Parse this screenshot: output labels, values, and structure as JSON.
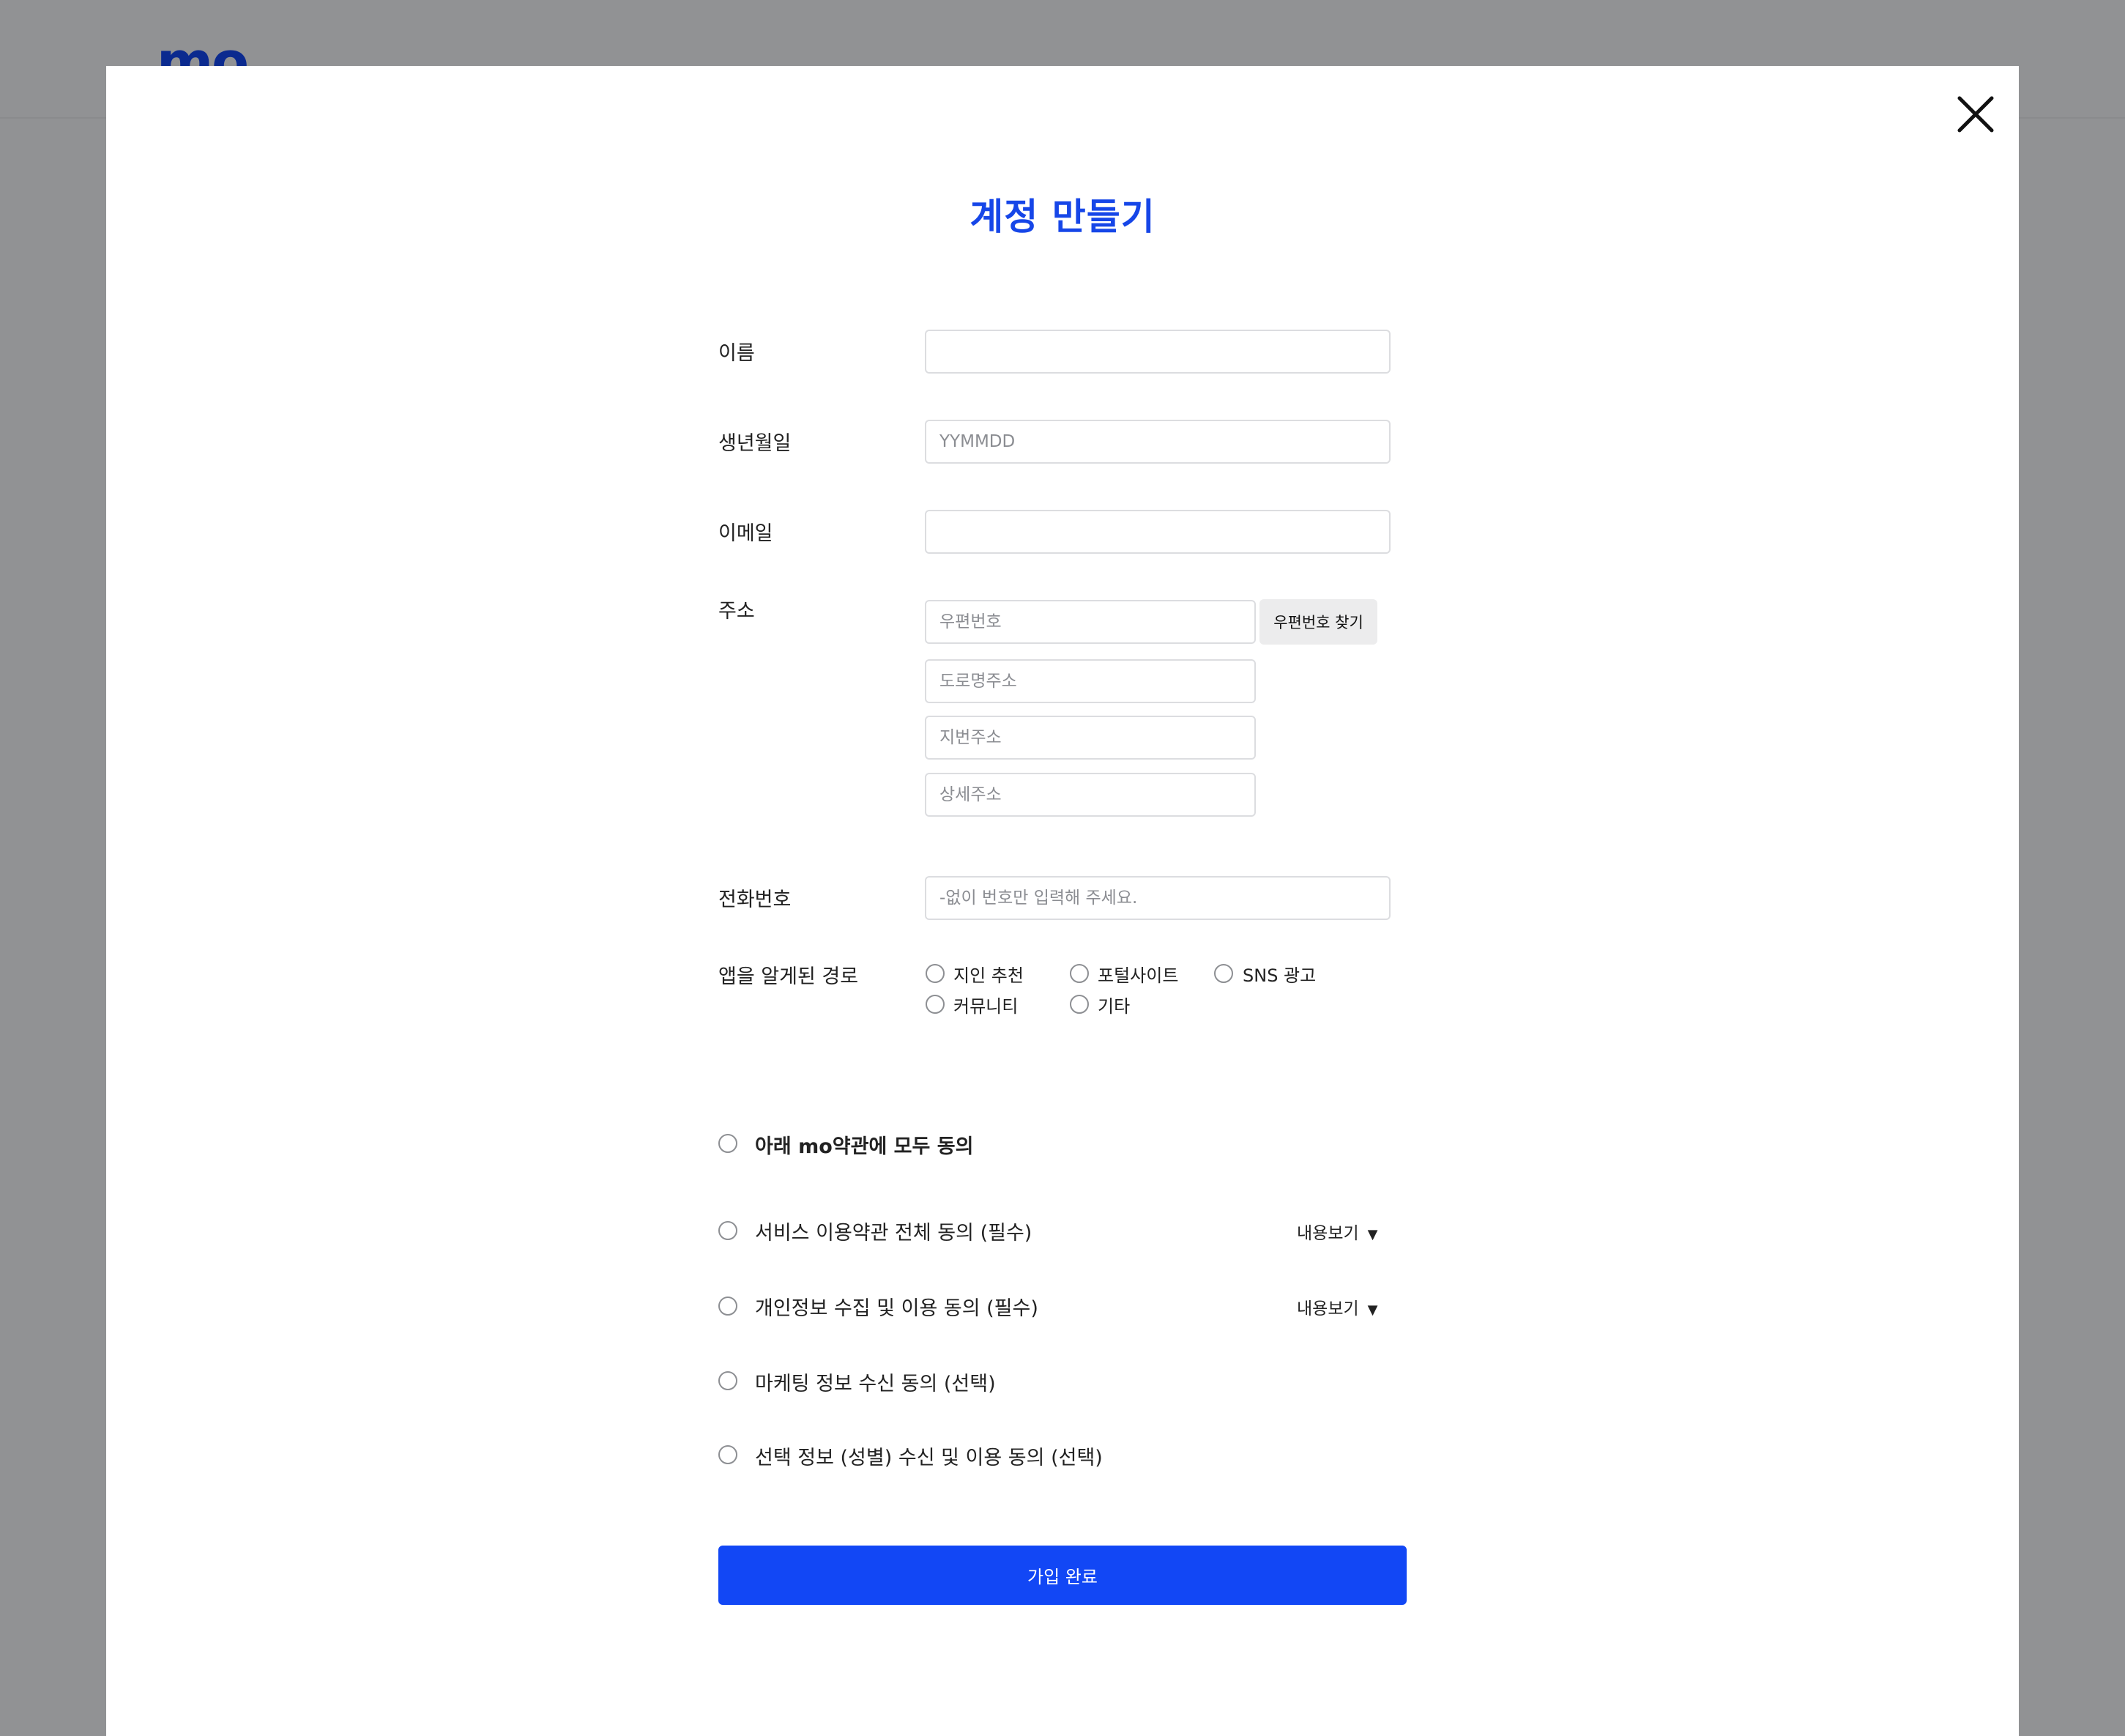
{
  "background": {
    "logo": "mo"
  },
  "modal": {
    "title": "계정 만들기",
    "close_icon": "close-icon"
  },
  "form": {
    "name": {
      "label": "이름",
      "value": "",
      "placeholder": ""
    },
    "birthdate": {
      "label": "생년월일",
      "value": "",
      "placeholder": "YYMMDD"
    },
    "email": {
      "label": "이메일",
      "value": "",
      "placeholder": ""
    },
    "address": {
      "label": "주소",
      "postcode_placeholder": "우편번호",
      "find_button": "우편번호 찾기",
      "road_placeholder": "도로명주소",
      "lot_placeholder": "지번주소",
      "detail_placeholder": "상세주소"
    },
    "phone": {
      "label": "전화번호",
      "value": "",
      "placeholder": "-없이 번호만 입력해 주세요."
    },
    "referral": {
      "label": "앱을 알게된 경로",
      "options": [
        "지인 추천",
        "포털사이트",
        "SNS 광고",
        "커뮤니티",
        "기타"
      ],
      "selected": null
    }
  },
  "terms": {
    "all": "아래 mo약관에 모두 동의",
    "items": [
      {
        "label": "서비스 이용약관 전체 동의 (필수)",
        "view": "내용보기"
      },
      {
        "label": "개인정보 수집 및 이용 동의 (필수)",
        "view": "내용보기"
      },
      {
        "label": "마케팅 정보 수신 동의 (선택)"
      },
      {
        "label": "선택 정보 (성별) 수신 및 이용 동의 (선택)"
      }
    ]
  },
  "submit_label": "가입 완료",
  "colors": {
    "accent": "#1646e8",
    "button": "#1247f5",
    "overlay": "#919294",
    "logo": "#0b2a8f"
  }
}
